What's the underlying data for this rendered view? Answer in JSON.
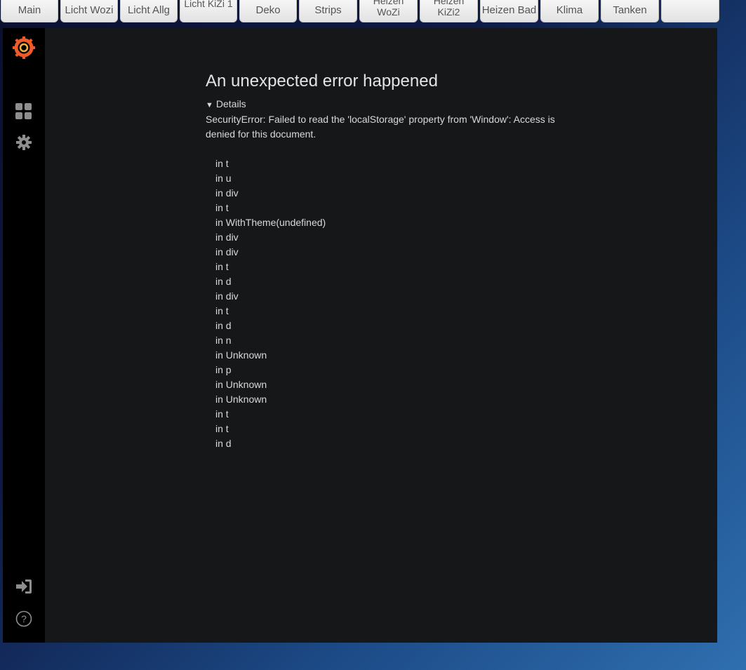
{
  "tabs": [
    {
      "label": "Main"
    },
    {
      "label": "Licht Wozi"
    },
    {
      "label": "Licht Allg"
    },
    {
      "label": "Licht KiZi 1"
    },
    {
      "label": "Deko"
    },
    {
      "label": "Strips"
    },
    {
      "label": "Heizen WoZi"
    },
    {
      "label": "Heizen KiZi2"
    },
    {
      "label": "Heizen Bad"
    },
    {
      "label": "Klima"
    },
    {
      "label": "Tanken"
    },
    {
      "label": ""
    }
  ],
  "sidemenu": {
    "icons": [
      "grafana-logo-icon",
      "dashboards-icon",
      "gear-icon",
      "sign-in-icon",
      "help-icon"
    ],
    "accent": "#f05a28"
  },
  "error": {
    "title": "An unexpected error happened",
    "details_label": "Details",
    "message": "SecurityError: Failed to read the 'localStorage' property from 'Window': Access is denied for this document.",
    "stack": [
      "in t",
      "in u",
      "in div",
      "in t",
      "in WithTheme(undefined)",
      "in div",
      "in div",
      "in t",
      "in d",
      "in div",
      "in t",
      "in d",
      "in n",
      "in Unknown",
      "in p",
      "in Unknown",
      "in Unknown",
      "in t",
      "in t",
      "in d"
    ]
  }
}
